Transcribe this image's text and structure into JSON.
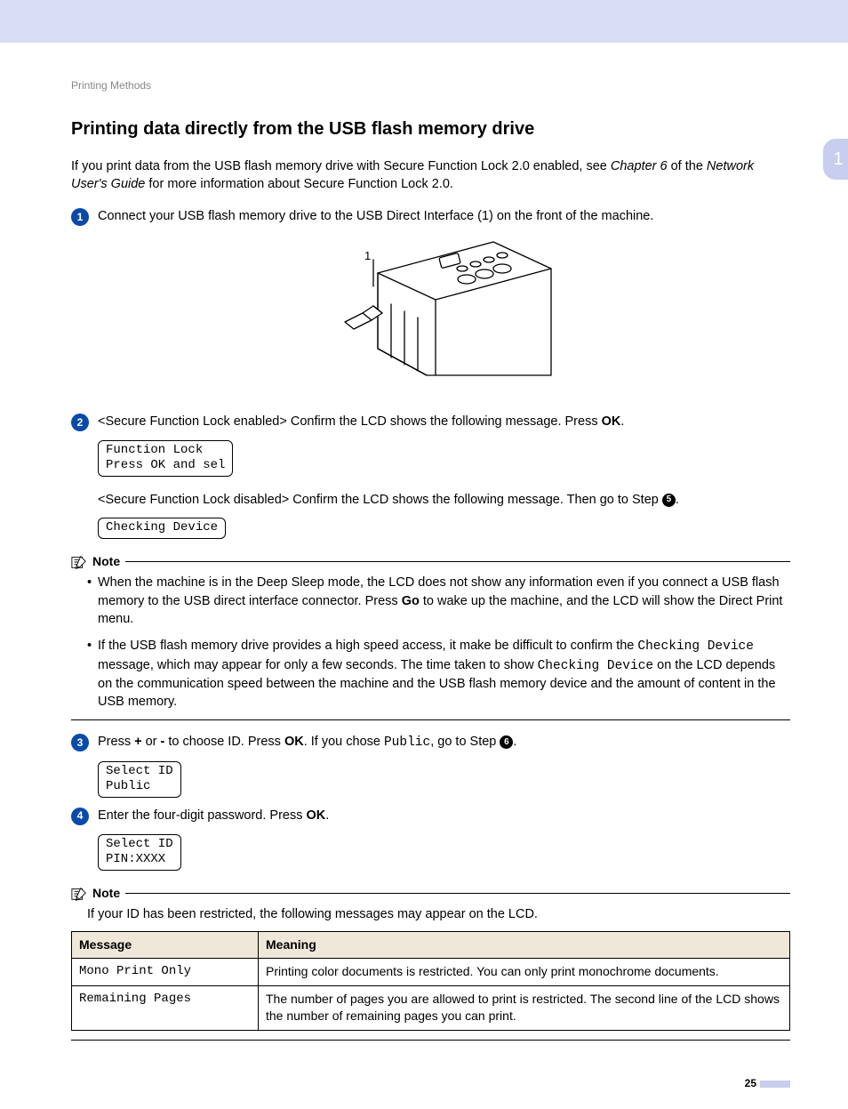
{
  "breadcrumb": "Printing Methods",
  "side_tab": "1",
  "title": "Printing data directly from the USB flash memory drive",
  "intro_a": "If you print data from the USB flash memory drive with Secure Function Lock 2.0 enabled, see ",
  "intro_chapter": "Chapter 6",
  "intro_b": " of the ",
  "intro_guide": "Network User's Guide",
  "intro_c": " for more information about Secure Function Lock 2.0.",
  "step1": {
    "n": "1",
    "text": "Connect your USB flash memory drive to the USB Direct Interface (1) on the front of the machine.",
    "callout": "1"
  },
  "step2": {
    "n": "2",
    "enabled_a": "<Secure Function Lock enabled> Confirm the LCD shows the following message. Press ",
    "ok": "OK",
    "enabled_b": ".",
    "lcd_enabled": "Function Lock\nPress OK and sel",
    "disabled_a": "<Secure Function Lock disabled> Confirm the LCD shows the following message. Then go to Step ",
    "disabled_step": "5",
    "disabled_b": ".",
    "lcd_disabled": "Checking Device"
  },
  "note1": {
    "label": "Note",
    "li1_a": "When the machine is in the Deep Sleep mode, the LCD does not show any information even if you connect a USB flash memory to the USB direct interface connector. Press ",
    "go": "Go",
    "li1_b": " to wake up the machine, and the LCD will show the Direct Print menu.",
    "li2_a": " If the USB flash memory drive provides a high speed access, it make be difficult to confirm the ",
    "cd1": "Checking Device",
    "li2_b": " message, which may appear for only a few seconds. The time taken to show ",
    "cd2": "Checking Device",
    "li2_c": " on the LCD depends on the communication speed between the machine and the USB flash memory device and the amount of content in the USB memory."
  },
  "step3": {
    "n": "3",
    "a": "Press ",
    "plus": "+",
    "or": " or ",
    "minus": "-",
    "b": " to choose ID. Press ",
    "ok": "OK",
    "c": ". If you chose ",
    "public": "Public",
    "d": ", go to Step ",
    "stepnum": "6",
    "e": ".",
    "lcd": "Select ID\nPublic"
  },
  "step4": {
    "n": "4",
    "a": "Enter the four-digit password. Press ",
    "ok": "OK",
    "b": ".",
    "lcd": "Select ID\nPIN:XXXX"
  },
  "note2": {
    "label": "Note",
    "text": "If your ID has been restricted, the following messages may appear on the LCD."
  },
  "table": {
    "h1": "Message",
    "h2": "Meaning",
    "r1c1": "Mono Print Only",
    "r1c2": "Printing color documents is restricted. You can only print monochrome documents.",
    "r2c1": "Remaining Pages",
    "r2c2": "The number of pages you are allowed to print is restricted. The second line of the LCD shows the number of remaining pages you can print."
  },
  "page_number": "25"
}
